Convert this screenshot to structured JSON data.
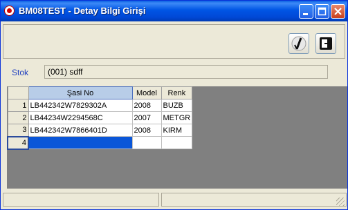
{
  "window": {
    "title": "BM08TEST - Detay Bilgi Girişi"
  },
  "titlebar_buttons": [
    "minimize-icon",
    "maximize-icon",
    "close-icon"
  ],
  "toolbar": {
    "buttons": [
      "check-icon",
      "exit-icon"
    ]
  },
  "stok": {
    "label": "Stok",
    "value": "(001) sdff"
  },
  "grid": {
    "columns": [
      "Şasi No",
      "Model",
      "Renk"
    ],
    "rows": [
      {
        "num": "1",
        "sasi": "LB442342W7829302A",
        "model": "2008",
        "renk": "BUZB"
      },
      {
        "num": "2",
        "sasi": "LB44234W2294568C",
        "model": "2007",
        "renk": "METGR"
      },
      {
        "num": "3",
        "sasi": "LB442342W7866401D",
        "model": "2008",
        "renk": "KIRM"
      },
      {
        "num": "4",
        "sasi": "",
        "model": "",
        "renk": ""
      }
    ]
  },
  "colors": {
    "titlebar": "#0055e5",
    "window_bg": "#ece9d8",
    "grid_bg": "#808080",
    "selection": "#0a56d8",
    "stok_label": "#1f3fbf"
  }
}
